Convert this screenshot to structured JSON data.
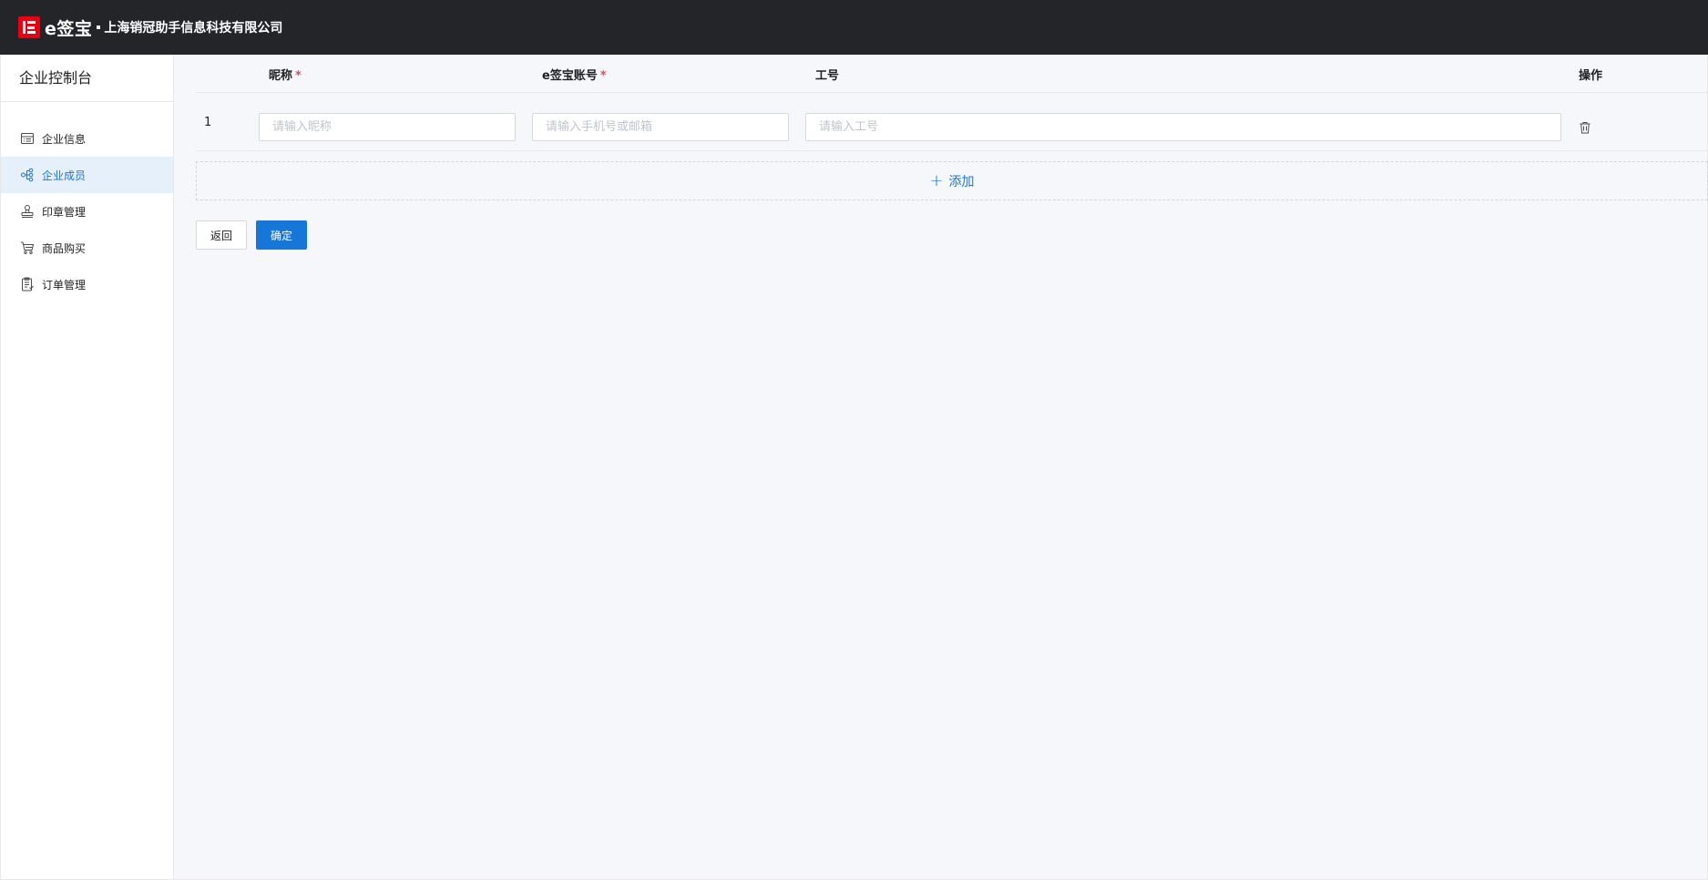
{
  "header": {
    "brand_name": "e签宝",
    "company_name": "上海销冠助手信息科技有限公司",
    "logo_icon": "esign-logo-icon"
  },
  "sidebar": {
    "title": "企业控制台",
    "items": [
      {
        "label": "企业信息",
        "icon": "enterprise-info-icon",
        "active": false
      },
      {
        "label": "企业成员",
        "icon": "members-icon",
        "active": true
      },
      {
        "label": "印章管理",
        "icon": "seal-icon",
        "active": false
      },
      {
        "label": "商品购买",
        "icon": "cart-icon",
        "active": false
      },
      {
        "label": "订单管理",
        "icon": "order-icon",
        "active": false
      }
    ]
  },
  "table": {
    "columns": {
      "name": "昵称",
      "account": "e签宝账号",
      "empno": "工号",
      "ops": "操作"
    },
    "required_mark": "*",
    "rows": [
      {
        "index": "1",
        "name_value": "",
        "name_placeholder": "请输入昵称",
        "account_value": "",
        "account_placeholder": "请输入手机号或邮箱",
        "empno_value": "",
        "empno_placeholder": "请输入工号"
      }
    ],
    "add_label": "添加"
  },
  "actions": {
    "back_label": "返回",
    "confirm_label": "确定"
  },
  "colors": {
    "topbar_bg": "#242529",
    "brand_red": "#e60012",
    "accent": "#1677d8",
    "required": "#e34d4d",
    "main_bg": "#f5f7fa"
  }
}
